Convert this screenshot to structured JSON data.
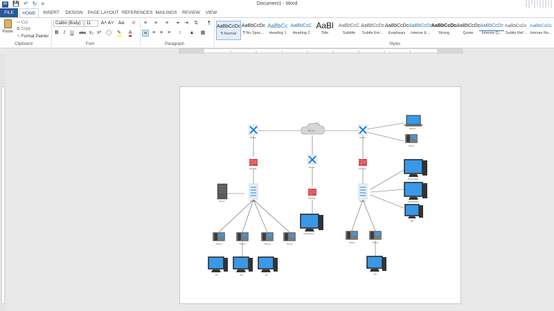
{
  "app": {
    "title": "Document1 - Word"
  },
  "quick_access": [
    "save-icon",
    "undo-icon",
    "redo-icon",
    "customize-icon"
  ],
  "tabs": [
    {
      "label": "FILE"
    },
    {
      "label": "HOME"
    },
    {
      "label": "INSERT"
    },
    {
      "label": "DESIGN"
    },
    {
      "label": "PAGE LAYOUT"
    },
    {
      "label": "REFERENCES"
    },
    {
      "label": "MAILINGS"
    },
    {
      "label": "REVIEW"
    },
    {
      "label": "VIEW"
    }
  ],
  "clipboard": {
    "paste": "Paste",
    "cut": "Cut",
    "copy": "Copy",
    "format_painter": "Format Painter",
    "group": "Clipboard"
  },
  "font": {
    "name": "Calibri (Body)",
    "size": "11",
    "group": "Font",
    "bold": "B",
    "italic": "I",
    "underline": "U",
    "strike": "abc",
    "subscript": "x₂",
    "superscript": "x²",
    "grow": "A˄",
    "shrink": "A˅",
    "change_case": "Aa",
    "clear": "⊘"
  },
  "paragraph": {
    "group": "Paragraph",
    "pilcrow": "¶"
  },
  "styles": {
    "group": "Styles",
    "items": [
      {
        "sample": "AaBbCcDc",
        "label": "¶ Normal"
      },
      {
        "sample": "AaBbCcDc",
        "label": "¶ No Spac..."
      },
      {
        "sample": "AaBbCc",
        "label": "Heading 1"
      },
      {
        "sample": "AaBbCcC",
        "label": "Heading 2"
      },
      {
        "sample": "AaBl",
        "label": "Title"
      },
      {
        "sample": "AaBbCcC",
        "label": "Subtitle"
      },
      {
        "sample": "AaBbCcDc",
        "label": "Subtle Em..."
      },
      {
        "sample": "AaBbCcDc",
        "label": "Emphasis"
      },
      {
        "sample": "AaBbCcDc",
        "label": "Intense E..."
      },
      {
        "sample": "AaBbCcDc",
        "label": "Strong"
      },
      {
        "sample": "AaBbCcDc",
        "label": "Quote"
      },
      {
        "sample": "AaBbCcDc",
        "label": "Intense Q..."
      },
      {
        "sample": "AaBbCcDc",
        "label": "Subtle Ref..."
      },
      {
        "sample": "AaBbCcDc",
        "label": "Intense Re..."
      }
    ]
  },
  "diagram": {
    "labels": {
      "internet": "Internet",
      "router": "Router",
      "firewall": "Firewall",
      "switch": "Switch",
      "server": "Server",
      "phone": "Phone",
      "pc": "PC",
      "laptop": "Laptop",
      "workstation": "Workstation"
    }
  },
  "colors": {
    "accent": "#2b579a",
    "router": "#1f7fd3",
    "firewall": "#d9464a",
    "monitor": "#3a98e6"
  }
}
